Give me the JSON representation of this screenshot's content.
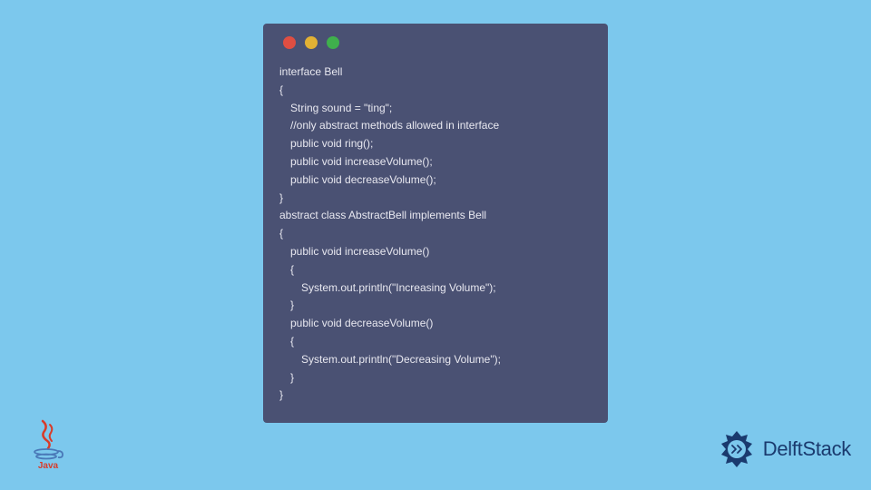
{
  "window": {
    "traffic_lights": [
      "red",
      "yellow",
      "green"
    ]
  },
  "code": {
    "lines": [
      "interface Bell",
      "{",
      " String sound = \"ting\";",
      " //only abstract methods allowed in interface",
      " public void ring(); ",
      " public void increaseVolume();",
      " public void decreaseVolume();",
      "}",
      "abstract class AbstractBell implements Bell",
      "{",
      " public void increaseVolume()",
      " {",
      "  System.out.println(\"Increasing Volume\");",
      " }",
      " public void decreaseVolume()",
      " {",
      "  System.out.println(\"Decreasing Volume\");",
      " }",
      "}"
    ]
  },
  "branding": {
    "java_label": "Java",
    "delft_stack_label": "DelftStack"
  },
  "colors": {
    "background": "#7cc8ed",
    "window_bg": "#4a5173",
    "code_text": "#e8e8f0",
    "java_red": "#d83c2a",
    "java_blue": "#4a79b8",
    "delft_blue": "#1a3a6e"
  }
}
